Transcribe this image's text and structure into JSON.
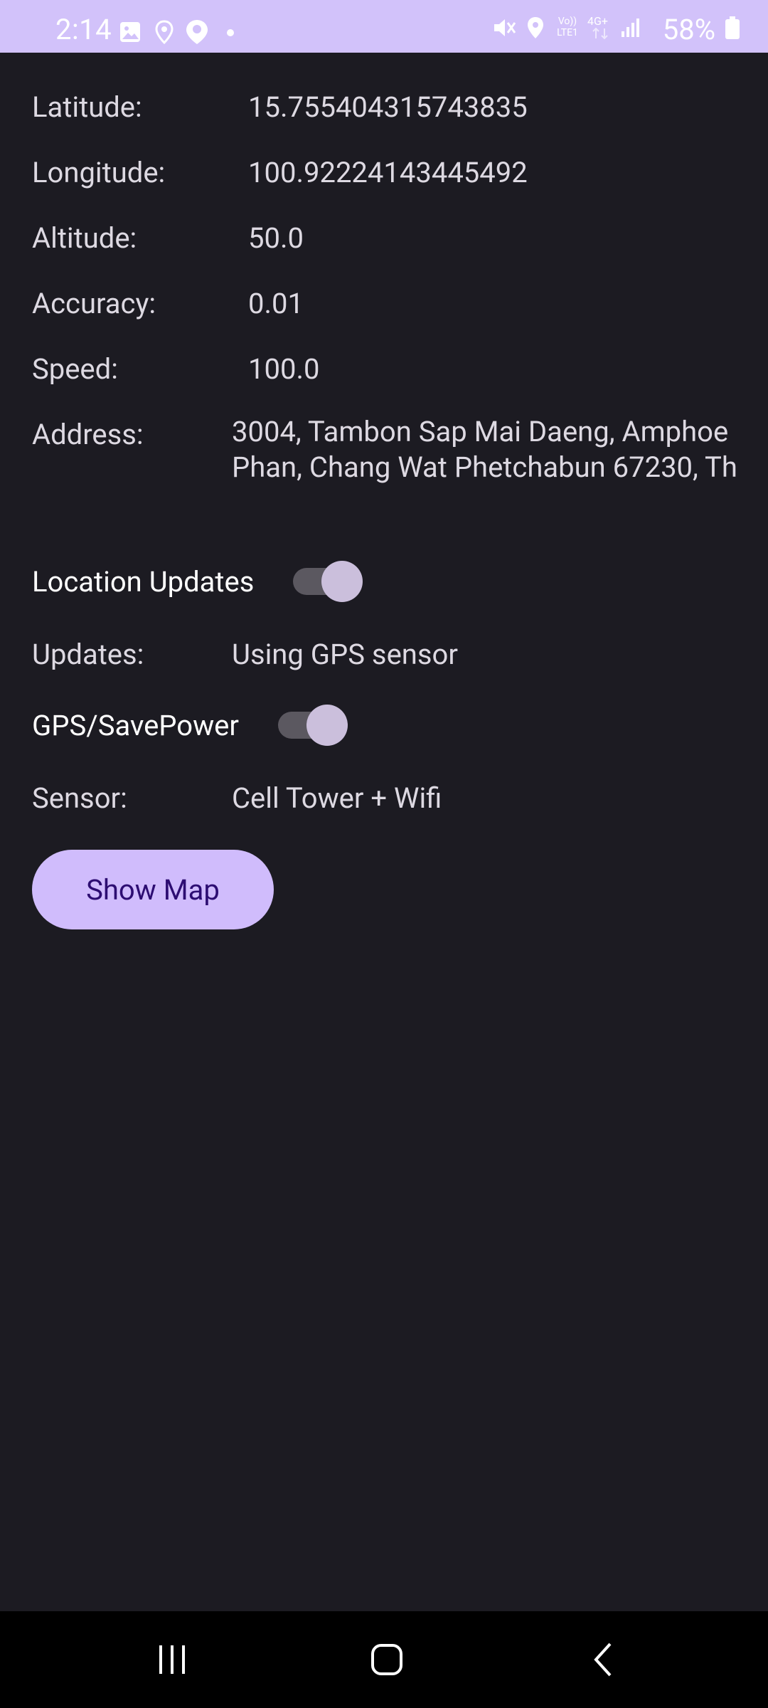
{
  "status_bar": {
    "time": "2:14",
    "battery": "58%",
    "network": "4G+",
    "volte": "Vo)) LTE1",
    "background": "#d2c2fa"
  },
  "info": {
    "latitude_label": "Latitude:",
    "latitude_value": "15.755404315743835",
    "longitude_label": "Longitude:",
    "longitude_value": "100.92224143445492",
    "altitude_label": "Altitude:",
    "altitude_value": "50.0",
    "accuracy_label": "Accuracy:",
    "accuracy_value": "0.01",
    "speed_label": "Speed:",
    "speed_value": "100.0",
    "address_label": "Address:",
    "address_line1": "3004, Tambon Sap Mai Daeng, Amphoe",
    "address_line2": "Phan, Chang Wat Phetchabun 67230, Th"
  },
  "settings": {
    "location_updates_label": "Location Updates",
    "location_updates_on": true,
    "updates_label": "Updates:",
    "updates_value": "Using GPS sensor",
    "gps_savepower_label": "GPS/SavePower",
    "gps_savepower_on": true,
    "sensor_label": "Sensor:",
    "sensor_value": "Cell Tower + Wifi"
  },
  "actions": {
    "show_map_label": "Show Map"
  },
  "colors": {
    "background": "#1c1b22",
    "accent_button": "#d0bcfc",
    "button_text": "#2d0d72",
    "switch_thumb": "#cbbfdc"
  }
}
